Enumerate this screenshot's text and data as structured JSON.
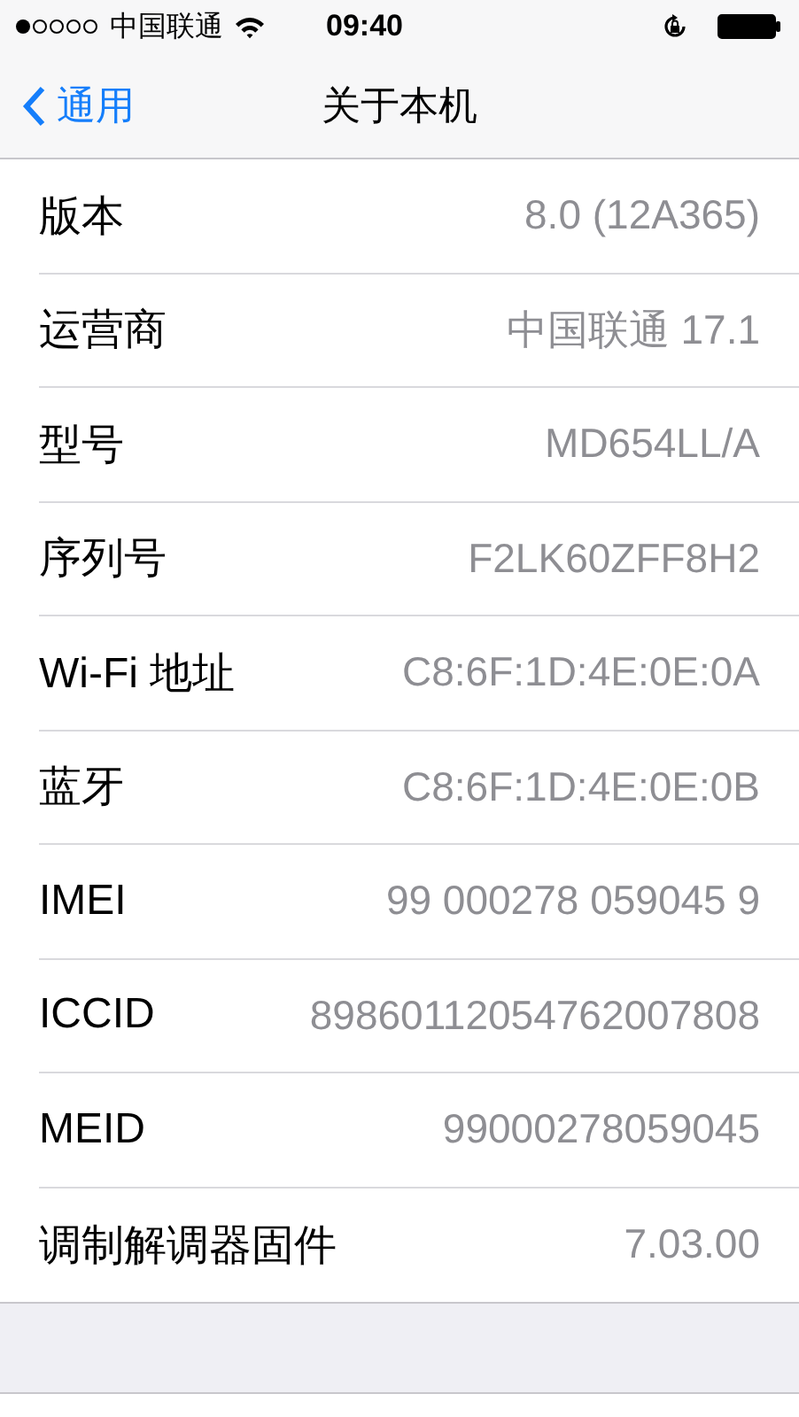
{
  "status_bar": {
    "carrier": "中国联通",
    "time": "09:40"
  },
  "nav_bar": {
    "back": "通用",
    "title": "关于本机"
  },
  "rows": [
    {
      "label": "版本",
      "value": "8.0 (12A365)"
    },
    {
      "label": "运营商",
      "value": "中国联通 17.1"
    },
    {
      "label": "型号",
      "value": "MD654LL/A"
    },
    {
      "label": "序列号",
      "value": "F2LK60ZFF8H2"
    },
    {
      "label": "Wi-Fi 地址",
      "value": "C8:6F:1D:4E:0E:0A"
    },
    {
      "label": "蓝牙",
      "value": "C8:6F:1D:4E:0E:0B"
    },
    {
      "label": "IMEI",
      "value": "99 000278 059045 9"
    },
    {
      "label": "ICCID",
      "value": "89860112054762007808"
    },
    {
      "label": "MEID",
      "value": "99000278059045"
    },
    {
      "label": "调制解调器固件",
      "value": "7.03.00"
    }
  ]
}
